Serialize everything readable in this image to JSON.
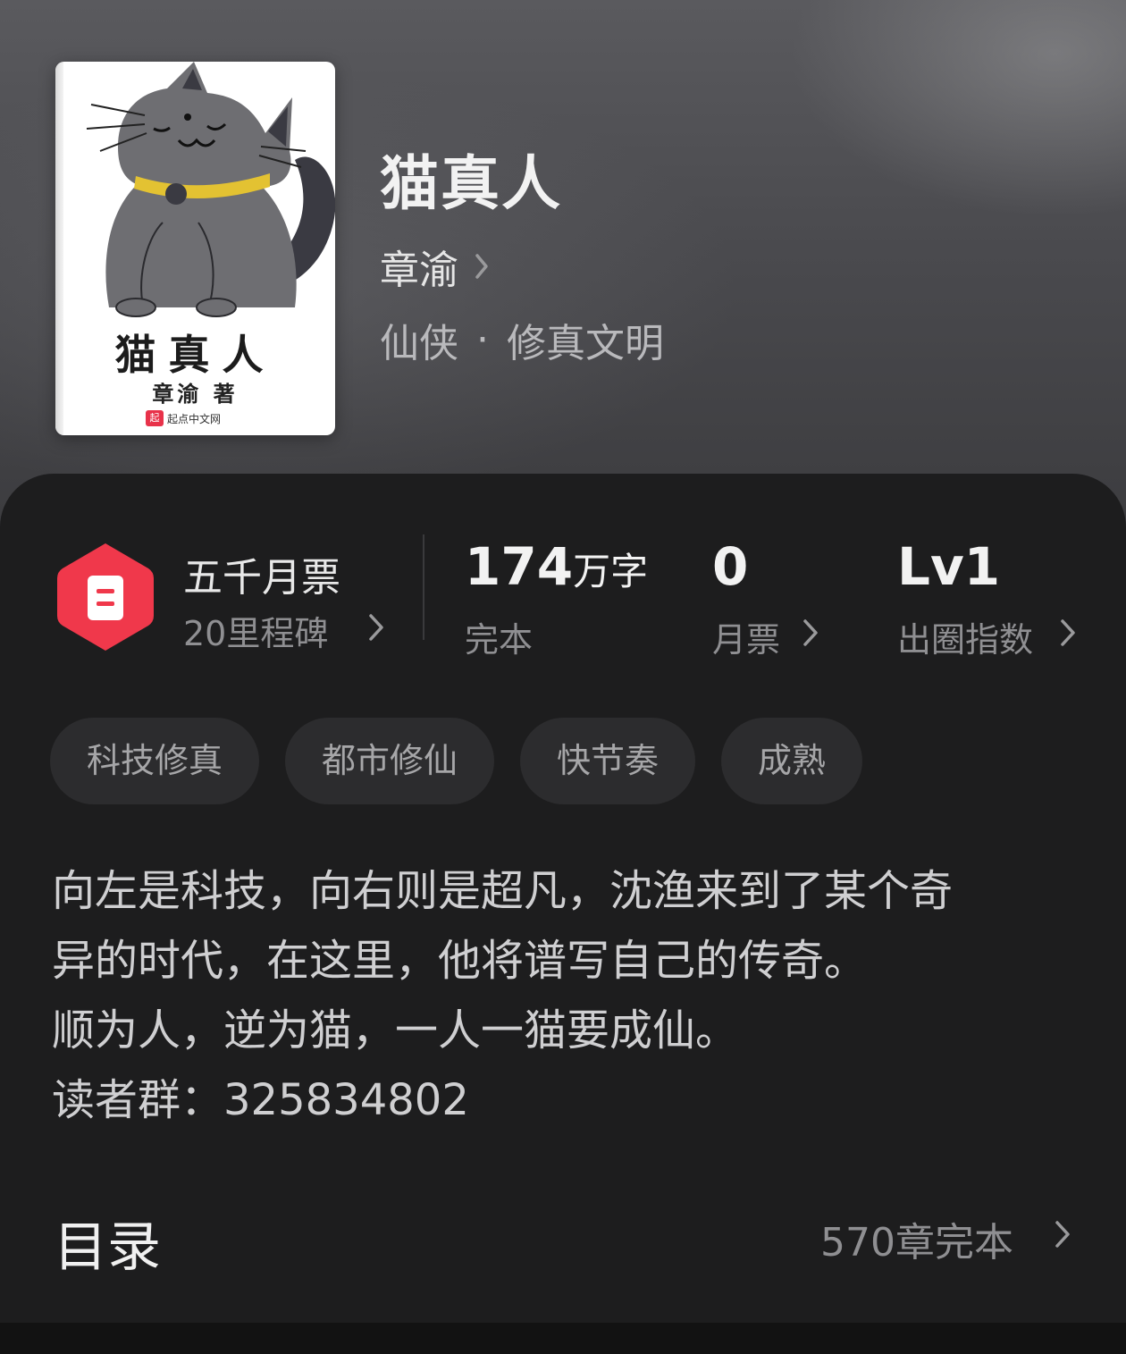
{
  "book": {
    "title": "猫真人",
    "author": "章渝",
    "genre_primary": "仙侠",
    "genre_separator": "·",
    "genre_secondary": "修真文明"
  },
  "cover": {
    "title": "猫真人",
    "author_line": "章渝 著",
    "publisher": "起点中文网",
    "publisher_logo_text": "起"
  },
  "stats": {
    "ticket_award": {
      "name": "五千月票",
      "sub": "20里程碑",
      "badge_color": "#f0384b"
    },
    "word_count": {
      "value": "174",
      "unit": "万字",
      "label": "完本"
    },
    "monthly_tickets": {
      "value": "0",
      "label": "月票"
    },
    "influence": {
      "value": "Lv1",
      "label": "出圈指数"
    }
  },
  "tags": [
    "科技修真",
    "都市修仙",
    "快节奏",
    "成熟"
  ],
  "description": [
    "向左是科技，向右则是超凡，沈渔来到了某个奇",
    "异的时代，在这里，他将谱写自己的传奇。",
    "顺为人，逆为猫，一人一猫要成仙。",
    "读者群：325834802"
  ],
  "toc": {
    "title": "目录",
    "summary": "570章完本"
  },
  "icons": {
    "author_arrow": "chevron-right-icon",
    "badge": "monthly-ticket-badge-icon"
  }
}
